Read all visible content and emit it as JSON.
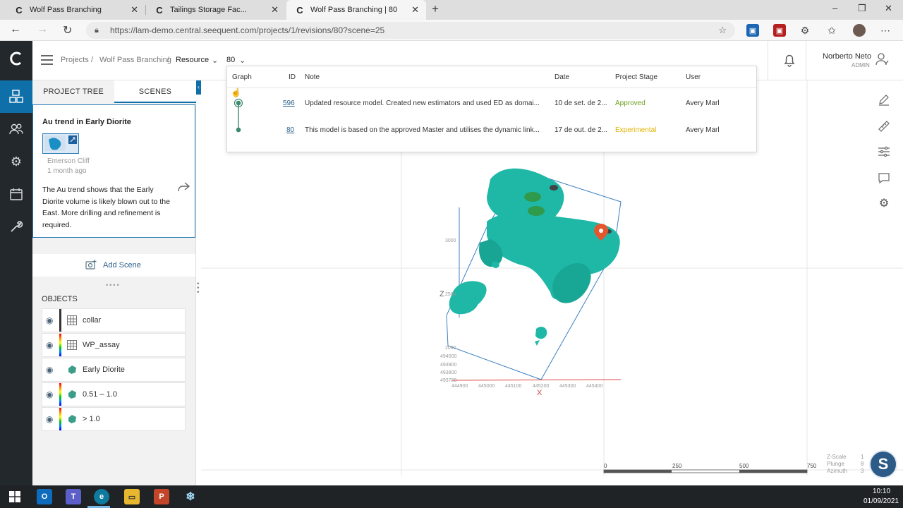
{
  "browser": {
    "tabs": [
      {
        "title": "Wolf Pass Branching",
        "active": false
      },
      {
        "title": "Tailings Storage Fac...",
        "active": false
      },
      {
        "title": "Wolf Pass Branching | 80",
        "active": true
      }
    ],
    "new_tab": "+",
    "url": "https://lam-demo.central.seequent.com/projects/1/revisions/80?scene=25",
    "window_controls": {
      "minimize": "–",
      "maximize": "❐",
      "close": "✕"
    }
  },
  "header": {
    "breadcrumb": {
      "projects": "Projects",
      "sep": "/",
      "project": "Wolf Pass Branching",
      "branch": "Resource",
      "revision": "80"
    },
    "user": {
      "name": "Norberto Neto",
      "role": "ADMIN"
    }
  },
  "left_panel": {
    "tabs": [
      "PROJECT TREE",
      "SCENES"
    ],
    "scene": {
      "title": "Au trend in Early Diorite",
      "author": "Emerson Cliff",
      "time": "1 month ago",
      "description": "The Au trend shows that the Early Diorite volume is likely blown out to the East. More drilling and refinement is required."
    },
    "add_scene": "Add Scene",
    "objects_heading": "OBJECTS",
    "objects": [
      {
        "label": "collar",
        "icon": "table-icon"
      },
      {
        "label": "WP_assay",
        "icon": "table-icon"
      },
      {
        "label": "Early Diorite",
        "icon": "mesh-icon"
      },
      {
        "label": "0.51 – 1.0",
        "icon": "mesh-icon"
      },
      {
        "label": "> 1.0",
        "icon": "mesh-icon"
      }
    ]
  },
  "revisions": {
    "columns": [
      "Graph",
      "ID",
      "Note",
      "Date",
      "Project Stage",
      "User"
    ],
    "rows": [
      {
        "id": "596",
        "note": "Updated resource model. Created new estimators and used ED as domai...",
        "date": "10 de set. de 2...",
        "stage": "Approved",
        "user": "Avery Marl"
      },
      {
        "id": "80",
        "note": "This model is based on the approved Master and utilises the dynamic link...",
        "date": "17 de out. de 2...",
        "stage": "Experimental",
        "user": "Avery Marl"
      }
    ],
    "colors": {
      "approved": "#6a9f1a",
      "experimental": "#e0b400",
      "link": "#2c5f8a",
      "graph": "#3d8a6e"
    }
  },
  "viewport": {
    "axis_z": "Z",
    "axis_x": "X",
    "z_ticks": [
      "3000",
      "2500",
      "2000"
    ],
    "y_ticks": [
      "494000",
      "493900",
      "493800",
      "493700"
    ],
    "x_ticks": [
      "444900",
      "445000",
      "445100",
      "445200",
      "445300",
      "445400"
    ],
    "scale_bar": [
      "0",
      "250",
      "500",
      "750"
    ],
    "view_info": [
      {
        "label": "Z-Scale",
        "value": "1"
      },
      {
        "label": "Plunge",
        "value": "8"
      },
      {
        "label": "Azimuth",
        "value": "3"
      }
    ],
    "colors": {
      "mesh": "#1fb8a6",
      "mesh_dark": "#14907f",
      "box": "#3c7fc2",
      "marker": "#e4572e"
    }
  },
  "taskbar": {
    "time": "10:10",
    "date": "01/09/2021"
  }
}
